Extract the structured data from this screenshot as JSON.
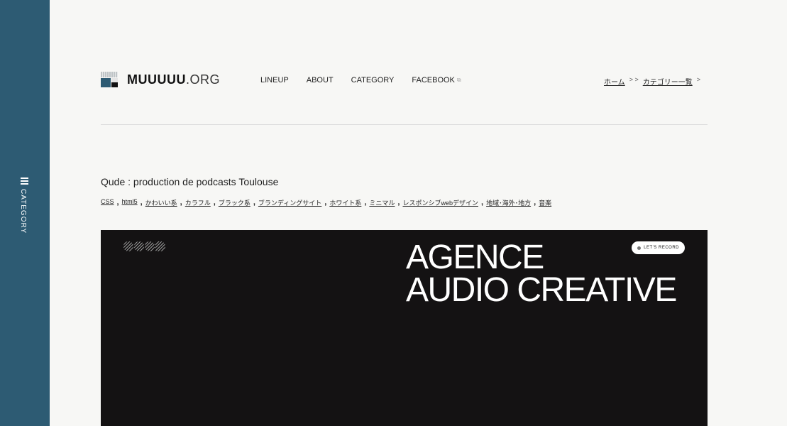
{
  "sidebar": {
    "label": "CATEGORY",
    "menu_icon": "hamburger-icon",
    "bg_color": "#2d5b73"
  },
  "header": {
    "logo_bold": "MUUUUU",
    "logo_rest": ".ORG",
    "nav": [
      {
        "label": "LINEUP"
      },
      {
        "label": "ABOUT"
      },
      {
        "label": "CATEGORY"
      },
      {
        "label": "FACEBOOK",
        "icon": "external-link-icon"
      }
    ],
    "breadcrumb": [
      {
        "label": "ホーム"
      },
      {
        "label": "カテゴリー一覧"
      }
    ],
    "breadcrumb_sep": ">"
  },
  "post": {
    "title": "Qude : production de podcasts Toulouse",
    "tags": [
      "CSS",
      "html5",
      "かわいい系",
      "カラフル",
      "ブラック系",
      "ブランディングサイト",
      "ホワイト系",
      "ミニマル",
      "レスポンシブwebデザイン",
      "地域･海外･地方",
      "音楽"
    ]
  },
  "hero": {
    "logo": "QUDE",
    "pill_label": "LET'S RECORD",
    "headline_line1": "AGENCE",
    "headline_line2": "AUDIO CREATIVE",
    "bg_color": "#141213"
  }
}
